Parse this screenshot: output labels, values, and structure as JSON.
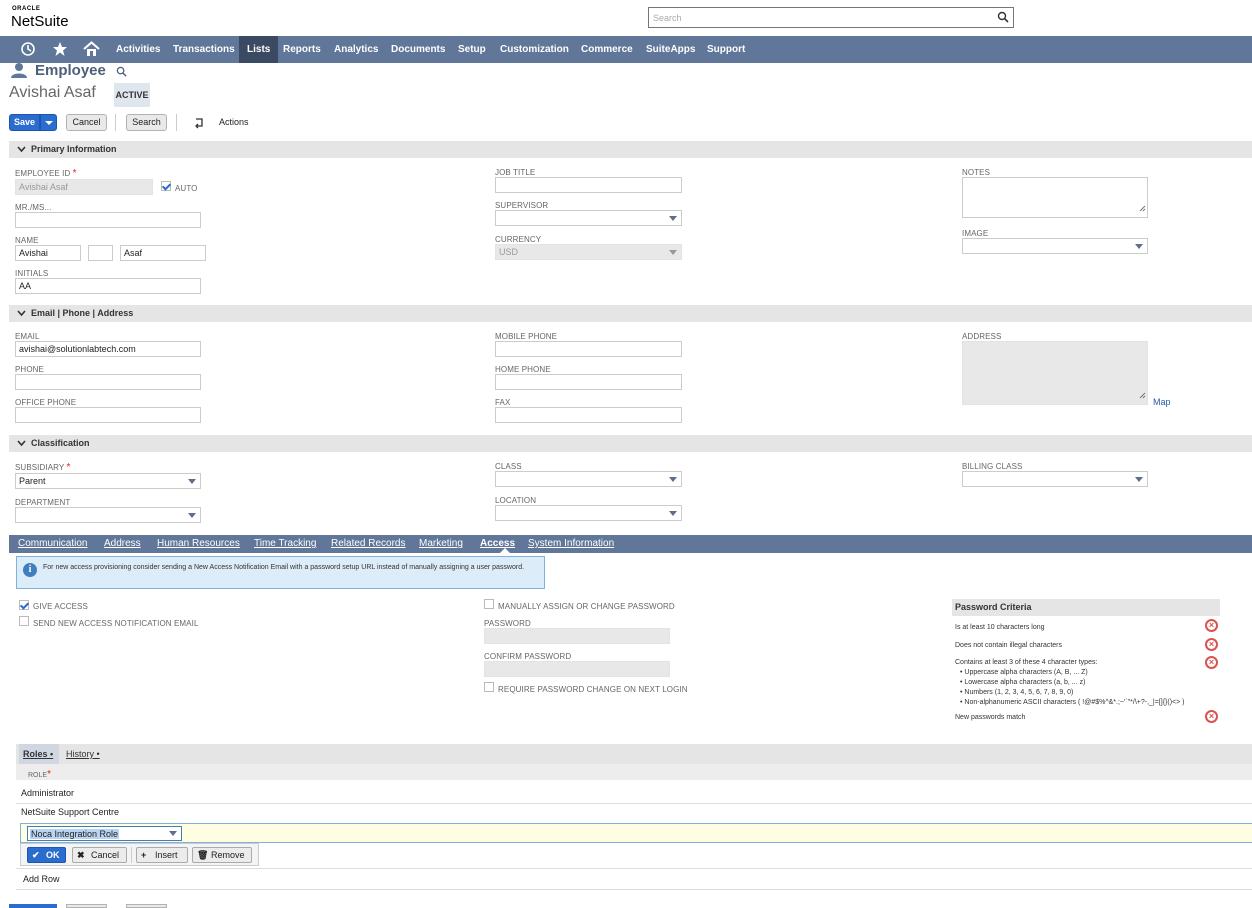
{
  "brand": {
    "oracle": "ORACLE",
    "netsuite": "NetSuite"
  },
  "global_search": {
    "placeholder": "Search"
  },
  "nav": {
    "items": [
      "Activities",
      "Transactions",
      "Lists",
      "Reports",
      "Analytics",
      "Documents",
      "Setup",
      "Customization",
      "Commerce",
      "SuiteApps",
      "Support"
    ],
    "active": "Lists"
  },
  "record": {
    "type": "Employee",
    "name": "Avishai Asaf",
    "status": "ACTIVE"
  },
  "toolbar": {
    "save": "Save",
    "cancel": "Cancel",
    "search": "Search",
    "actions": "Actions"
  },
  "primary": {
    "title": "Primary Information",
    "employee_id_label": "EMPLOYEE ID",
    "employee_id_value": "Avishai Asaf",
    "auto_label": "AUTO",
    "mr_label": "MR./MS...",
    "name_label": "NAME",
    "first_name": "Avishai",
    "last_name": "Asaf",
    "initials_label": "INITIALS",
    "initials_value": "AA",
    "job_title_label": "JOB TITLE",
    "supervisor_label": "SUPERVISOR",
    "currency_label": "CURRENCY",
    "currency_value": "USD",
    "notes_label": "NOTES",
    "image_label": "IMAGE"
  },
  "contact": {
    "title": "Email | Phone | Address",
    "email_label": "EMAIL",
    "email_value": "avishai@solutionlabtech.com",
    "phone_label": "PHONE",
    "office_phone_label": "OFFICE PHONE",
    "mobile_phone_label": "MOBILE PHONE",
    "home_phone_label": "HOME PHONE",
    "fax_label": "FAX",
    "address_label": "ADDRESS",
    "map_link": "Map"
  },
  "classification": {
    "title": "Classification",
    "subsidiary_label": "SUBSIDIARY",
    "subsidiary_value": "Parent",
    "department_label": "DEPARTMENT",
    "class_label": "CLASS",
    "location_label": "LOCATION",
    "billing_class_label": "BILLING CLASS"
  },
  "subtabs": [
    "Communication",
    "Address",
    "Human Resources",
    "Time Tracking",
    "Related Records",
    "Marketing",
    "Access",
    "System Information"
  ],
  "access": {
    "info": "For new access provisioning consider sending a New Access Notification Email with a password setup URL instead of manually assigning a user password.",
    "give_access": "GIVE ACCESS",
    "send_notification": "SEND NEW ACCESS NOTIFICATION EMAIL",
    "manually_assign": "MANUALLY ASSIGN OR CHANGE PASSWORD",
    "password_label": "PASSWORD",
    "confirm_password_label": "CONFIRM PASSWORD",
    "require_change": "REQUIRE PASSWORD CHANGE ON NEXT LOGIN"
  },
  "password_criteria": {
    "title": "Password Criteria",
    "rule1": "Is at least 10 characters long",
    "rule2": "Does not contain illegal characters",
    "rule3": "Contains at least 3 of these 4 character types:",
    "types": [
      "• Uppercase alpha characters (A, B, ... Z)",
      "• Lowercase alpha characters (a, b, ... z)",
      "• Numbers (1, 2, 3, 4, 5, 6, 7, 8, 9, 0)",
      "• Non-alphanumeric ASCII characters ( !@#$%^&*.;~'`\"*/\\+?-,_|=[]{}()<> )"
    ],
    "rule4": "New passwords match"
  },
  "roles": {
    "tab_roles": "Roles",
    "tab_history": "History",
    "col_role": "ROLE",
    "rows": [
      "Administrator",
      "NetSuite Support Centre"
    ],
    "editing_value": "Noca Integration Role",
    "btn_ok": "OK",
    "btn_cancel": "Cancel",
    "btn_insert": "Insert",
    "btn_remove": "Remove",
    "add_row": "Add Row"
  }
}
